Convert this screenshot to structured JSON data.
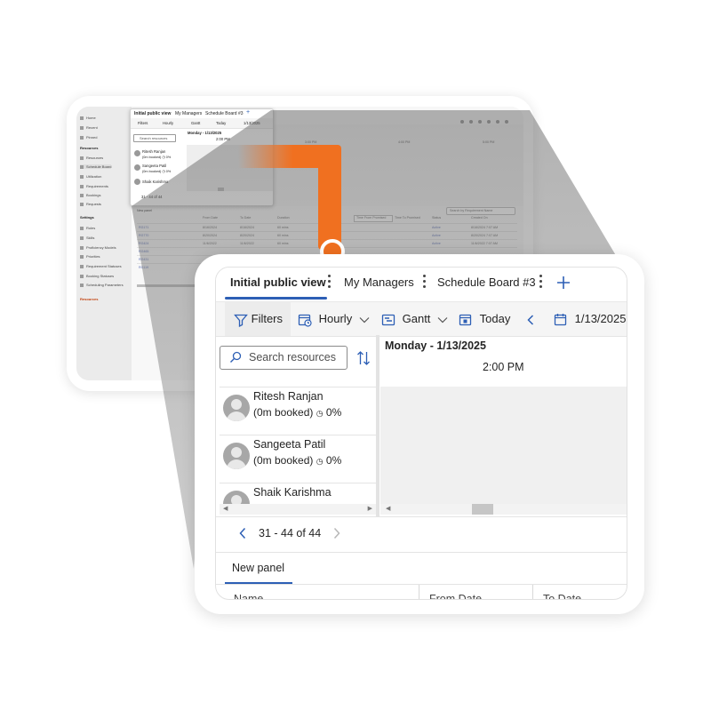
{
  "zoom": {
    "tabs": [
      {
        "label": "Initial public view",
        "active": true
      },
      {
        "label": "My Managers",
        "active": false
      },
      {
        "label": "Schedule Board #3",
        "active": false
      }
    ],
    "toolbar": {
      "filters": "Filters",
      "hourly": "Hourly",
      "gantt": "Gantt",
      "today": "Today",
      "date": "1/13/2025"
    },
    "search_placeholder": "Search resources",
    "day_header": "Monday - 1/13/2025",
    "time_header": "2:00 PM",
    "resources": [
      {
        "name": "Ritesh Ranjan",
        "booked": "(0m booked)",
        "pct": "0%"
      },
      {
        "name": "Sangeeta Patil",
        "booked": "(0m booked)",
        "pct": "0%"
      },
      {
        "name": "Shaik Karishma",
        "booked": "",
        "pct": ""
      }
    ],
    "pagination": "31 - 44 of 44",
    "panel_tab": "New panel",
    "columns": [
      "Name",
      "From Date",
      "To Date"
    ]
  },
  "mini": {
    "nav_items": [
      "Home",
      "Recent",
      "Pinned"
    ],
    "nav_section_1": "Resources",
    "nav_items_1": [
      "Resources",
      "Schedule Board",
      "Utilization",
      "Requirements",
      "Bookings",
      "Requests"
    ],
    "nav_section_2": "Settings",
    "nav_items_2": [
      "Roles",
      "Skills",
      "Proficiency Models",
      "Priorities",
      "Requirement Statuses",
      "Booking Statuses",
      "Scheduling Parameters"
    ],
    "nav_footer": "Resources",
    "inset_tabs": [
      "Initial public view",
      "My Managers",
      "Schedule Board #3"
    ],
    "inset_toolbar": [
      "Filters",
      "Hourly",
      "Gantt",
      "Today",
      "1/13/2025",
      "Book"
    ],
    "inset_search": "Search resources",
    "inset_day": "Monday - 1/13/2025",
    "inset_time": "2:00 PM",
    "inset_resources": [
      {
        "name": "Ritesh Ranjan",
        "sub": "(0m booked) ◷ 0%"
      },
      {
        "name": "Sangeeta Patil",
        "sub": "(0m booked) ◷ 0%"
      },
      {
        "name": "Shaik Karishma",
        "sub": ""
      }
    ],
    "inset_pagination": "31 - 44 of 44",
    "times": [
      "3:00 PM",
      "4:00 PM",
      "5:00 PM"
    ],
    "req_search": "Search by Requirement Name",
    "panel_tab": "New panel",
    "buttons": [
      "Time From Promised",
      "Time To Promised"
    ],
    "columns": [
      "From Date",
      "To Date",
      "Duration",
      "Status",
      "Created On"
    ],
    "rows": [
      {
        "name": "RG171",
        "from": "8/16/2024",
        "to": "8/16/2024",
        "dur": "60 mins",
        "status": "Active",
        "created": "8/16/2024 7:07 AM"
      },
      {
        "name": "RG770",
        "from": "8/20/2024",
        "to": "8/20/2024",
        "dur": "60 mins",
        "status": "Active",
        "created": "8/20/2024 7:07 AM"
      },
      {
        "name": "RG424",
        "from": "11/6/2022",
        "to": "11/6/2022",
        "dur": "60 mins",
        "status": "Active",
        "created": "11/6/2022 7:07 AM"
      },
      {
        "name": "RG465",
        "from": "",
        "to": "",
        "dur": "",
        "status": "",
        "created": ""
      },
      {
        "name": "RG431",
        "from": "",
        "to": "",
        "dur": "",
        "status": "",
        "created": ""
      },
      {
        "name": "RG119",
        "from": "",
        "to": "",
        "dur": "",
        "status": "",
        "created": ""
      }
    ]
  },
  "colors": {
    "accent": "#2d5fb5",
    "connector": "#f07020",
    "link": "#3466b8"
  }
}
